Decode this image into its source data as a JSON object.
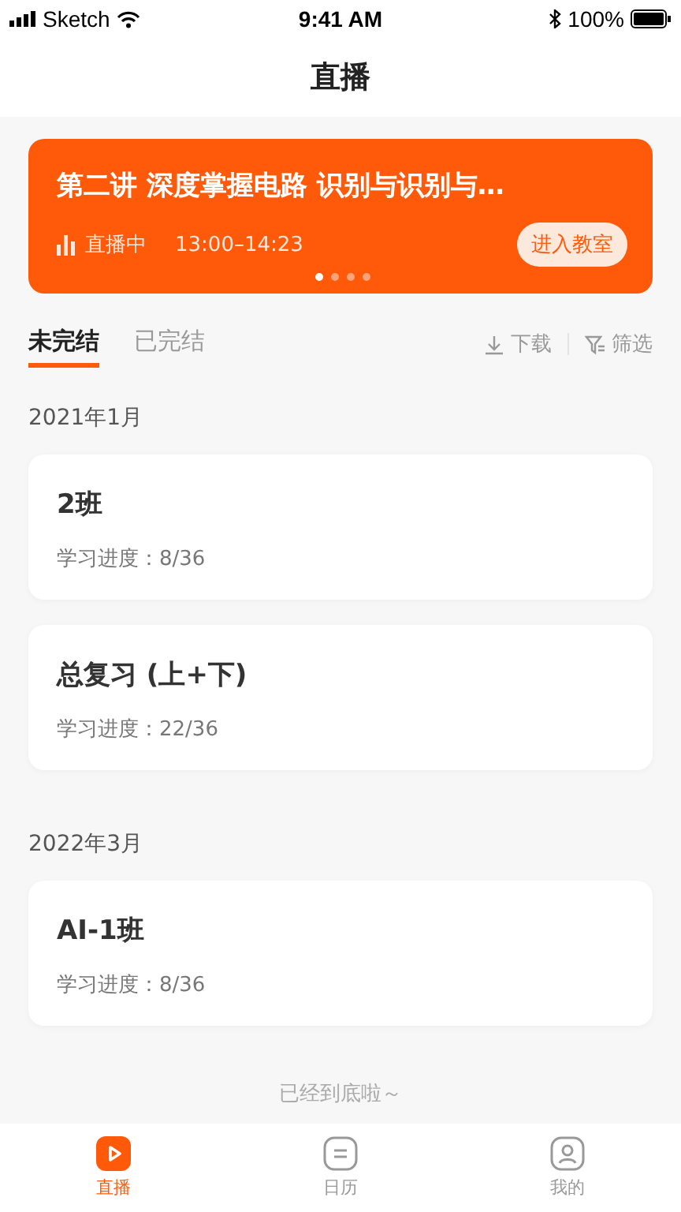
{
  "status_bar": {
    "carrier": "Sketch",
    "time": "9:41 AM",
    "battery": "100%"
  },
  "header": {
    "title": "直播"
  },
  "banner": {
    "title": "第二讲 深度掌握电路 识别与识别与…",
    "status": "直播中",
    "time": "13:00–14:23",
    "button": "进入教室",
    "dots": [
      {
        "selected": true
      },
      {
        "selected": false
      },
      {
        "selected": false
      },
      {
        "selected": false
      }
    ]
  },
  "tabs": [
    {
      "label": "未完结",
      "selected": true
    },
    {
      "label": "已完结",
      "selected": false
    }
  ],
  "actions": [
    {
      "kind": "download",
      "label": "下载"
    },
    {
      "kind": "filter",
      "label": "筛选"
    }
  ],
  "groups": [
    {
      "label": "2021年1月",
      "courses": [
        {
          "title": "2班",
          "progress": "学习进度：8/36"
        },
        {
          "title": "总复习 (上+下)",
          "progress": "学习进度：22/36"
        }
      ]
    },
    {
      "label": "2022年3月",
      "courses": [
        {
          "title": "AI-1班",
          "progress": "学习进度：8/36"
        }
      ]
    }
  ],
  "footer_note": "已经到底啦～",
  "tab_bar": [
    {
      "kind": "live",
      "label": "直播",
      "selected": true
    },
    {
      "kind": "calendar",
      "label": "日历",
      "selected": false
    },
    {
      "kind": "profile",
      "label": "我的",
      "selected": false
    }
  ]
}
